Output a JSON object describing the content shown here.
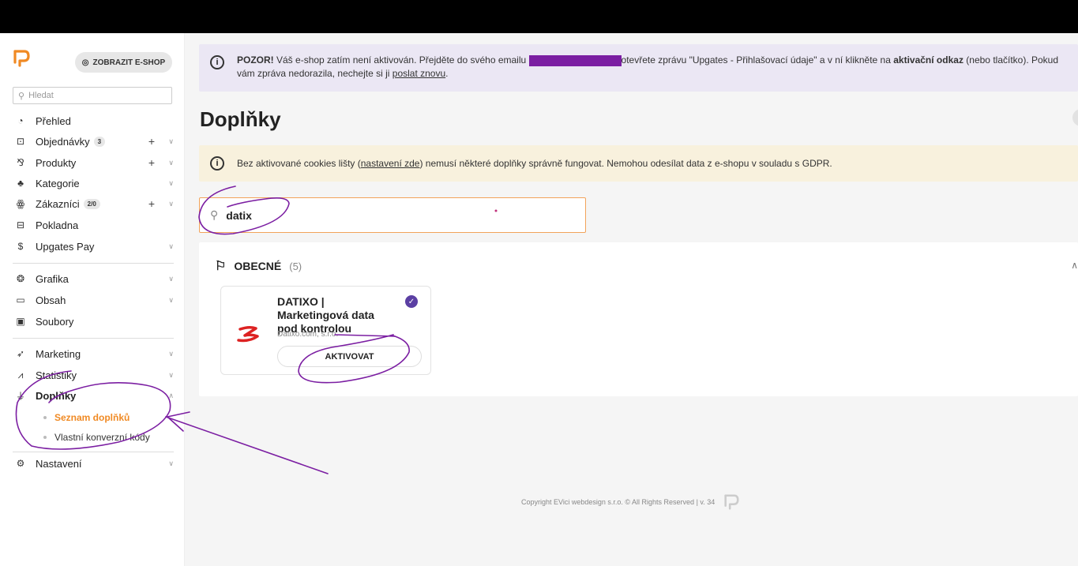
{
  "sidebar": {
    "eshop_button": "ZOBRAZIT E-SHOP",
    "search_placeholder": "Hledat",
    "items": [
      {
        "label": "Přehled"
      },
      {
        "label": "Objednávky",
        "badge": "3"
      },
      {
        "label": "Produkty"
      },
      {
        "label": "Kategorie"
      },
      {
        "label": "Zákazníci",
        "badge": "2/0"
      },
      {
        "label": "Pokladna"
      },
      {
        "label": "Upgates Pay"
      },
      {
        "label": "Grafika"
      },
      {
        "label": "Obsah"
      },
      {
        "label": "Soubory"
      },
      {
        "label": "Marketing"
      },
      {
        "label": "Statistiky"
      },
      {
        "label": "Doplňky"
      },
      {
        "label": "Nastavení"
      }
    ],
    "sub_items": [
      {
        "label": "Seznam doplňků"
      },
      {
        "label": "Vlastní konverzní kódy"
      }
    ]
  },
  "alert": {
    "strong": "POZOR!",
    "text1": " Váš e-shop zatím není aktivován. Přejděte do svého emailu ",
    "text2": "otevřete zprávu \"Upgates - Přihlašovací údaje\" a v ní klikněte na ",
    "link_bold": "aktivační odkaz",
    "text3": " (nebo tlačítko). Pokud vám zpráva nedorazila, nechejte si ji ",
    "link": "poslat znovu",
    "text4": "."
  },
  "page_title": "Doplňky",
  "cookie_warning": {
    "text1": "Bez aktivované cookies lišty (",
    "link": "nastavení zde",
    "text2": ") nemusí některé doplňky správně fungovat. Nemohou odesílat data z e-shopu v souladu s GDPR."
  },
  "addon_search": {
    "value": "datix"
  },
  "section": {
    "title": "OBECNÉ",
    "count": "(5)"
  },
  "addon_card": {
    "title": "DATIXO | Marketingová data pod kontrolou",
    "vendor": "Datixo.com, s.r.o.",
    "button": "AKTIVOVAT"
  },
  "footer": {
    "text": "Copyright EVici webdesign s.r.o. © All Rights Reserved | v. 34"
  },
  "colors": {
    "accent": "#f08a24",
    "annotation": "#7b1ea2",
    "alert_bg": "#ebe7f4",
    "warn_bg": "#f8f1dd"
  }
}
